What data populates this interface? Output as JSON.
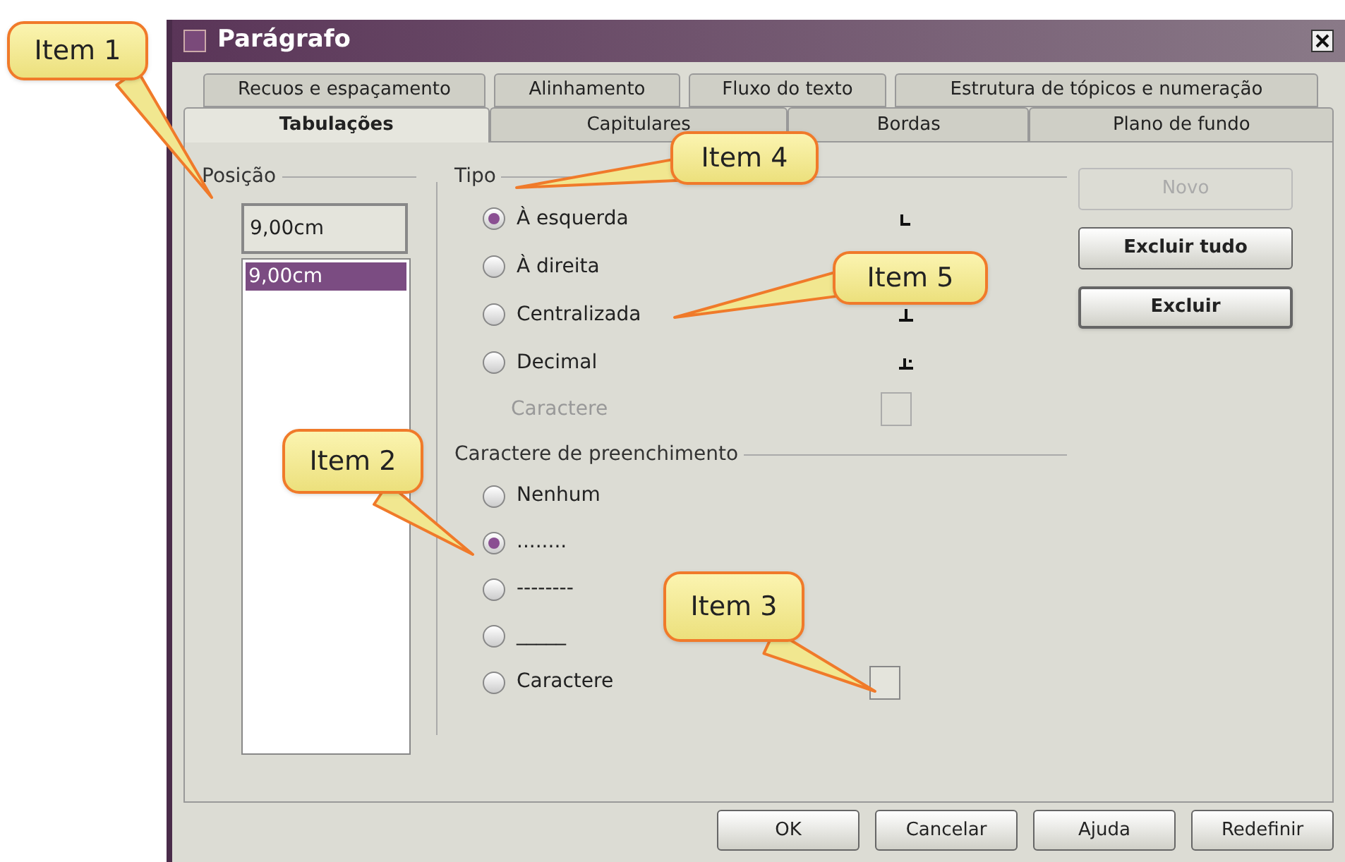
{
  "window": {
    "title": "Parágrafo"
  },
  "tab_rows": [
    [
      {
        "label": "Recuos e espaçamento",
        "selected": false
      },
      {
        "label": "Alinhamento",
        "selected": false
      },
      {
        "label": "Fluxo do texto",
        "selected": false
      },
      {
        "label": "Estrutura de tópicos e numeração",
        "selected": false
      }
    ],
    [
      {
        "label": "Tabulações",
        "selected": true
      },
      {
        "label": "Capitulares",
        "selected": false
      },
      {
        "label": "Bordas",
        "selected": false
      },
      {
        "label": "Plano de fundo",
        "selected": false
      }
    ]
  ],
  "position": {
    "label": "Posição",
    "value": "9,00cm",
    "items": [
      {
        "label": "9,00cm",
        "selected": true
      }
    ]
  },
  "type": {
    "label": "Tipo",
    "options": [
      {
        "label": "À esquerda",
        "selected": true
      },
      {
        "label": "À direita",
        "selected": false
      },
      {
        "label": "Centralizada",
        "selected": false
      },
      {
        "label": "Decimal",
        "selected": false
      }
    ],
    "character": {
      "label": "Caractere",
      "disabled": true
    }
  },
  "fill": {
    "label": "Caractere de preenchimento",
    "options": [
      {
        "label": "Nenhum",
        "selected": false
      },
      {
        "label": "........",
        "selected": true
      },
      {
        "label": "--------",
        "selected": false
      },
      {
        "label": "_____",
        "selected": false
      },
      {
        "label": "Caractere",
        "selected": false
      }
    ]
  },
  "side_buttons": [
    {
      "label": "Novo",
      "disabled": true,
      "focused": false
    },
    {
      "label": "Excluir tudo",
      "disabled": false,
      "focused": false
    },
    {
      "label": "Excluir",
      "disabled": false,
      "focused": true
    }
  ],
  "footer_buttons": [
    {
      "label": "OK"
    },
    {
      "label": "Cancelar"
    },
    {
      "label": "Ajuda"
    },
    {
      "label": "Redefinir"
    }
  ],
  "callouts": [
    {
      "label": "Item 1"
    },
    {
      "label": "Item 2"
    },
    {
      "label": "Item 3"
    },
    {
      "label": "Item 4"
    },
    {
      "label": "Item 5"
    }
  ]
}
